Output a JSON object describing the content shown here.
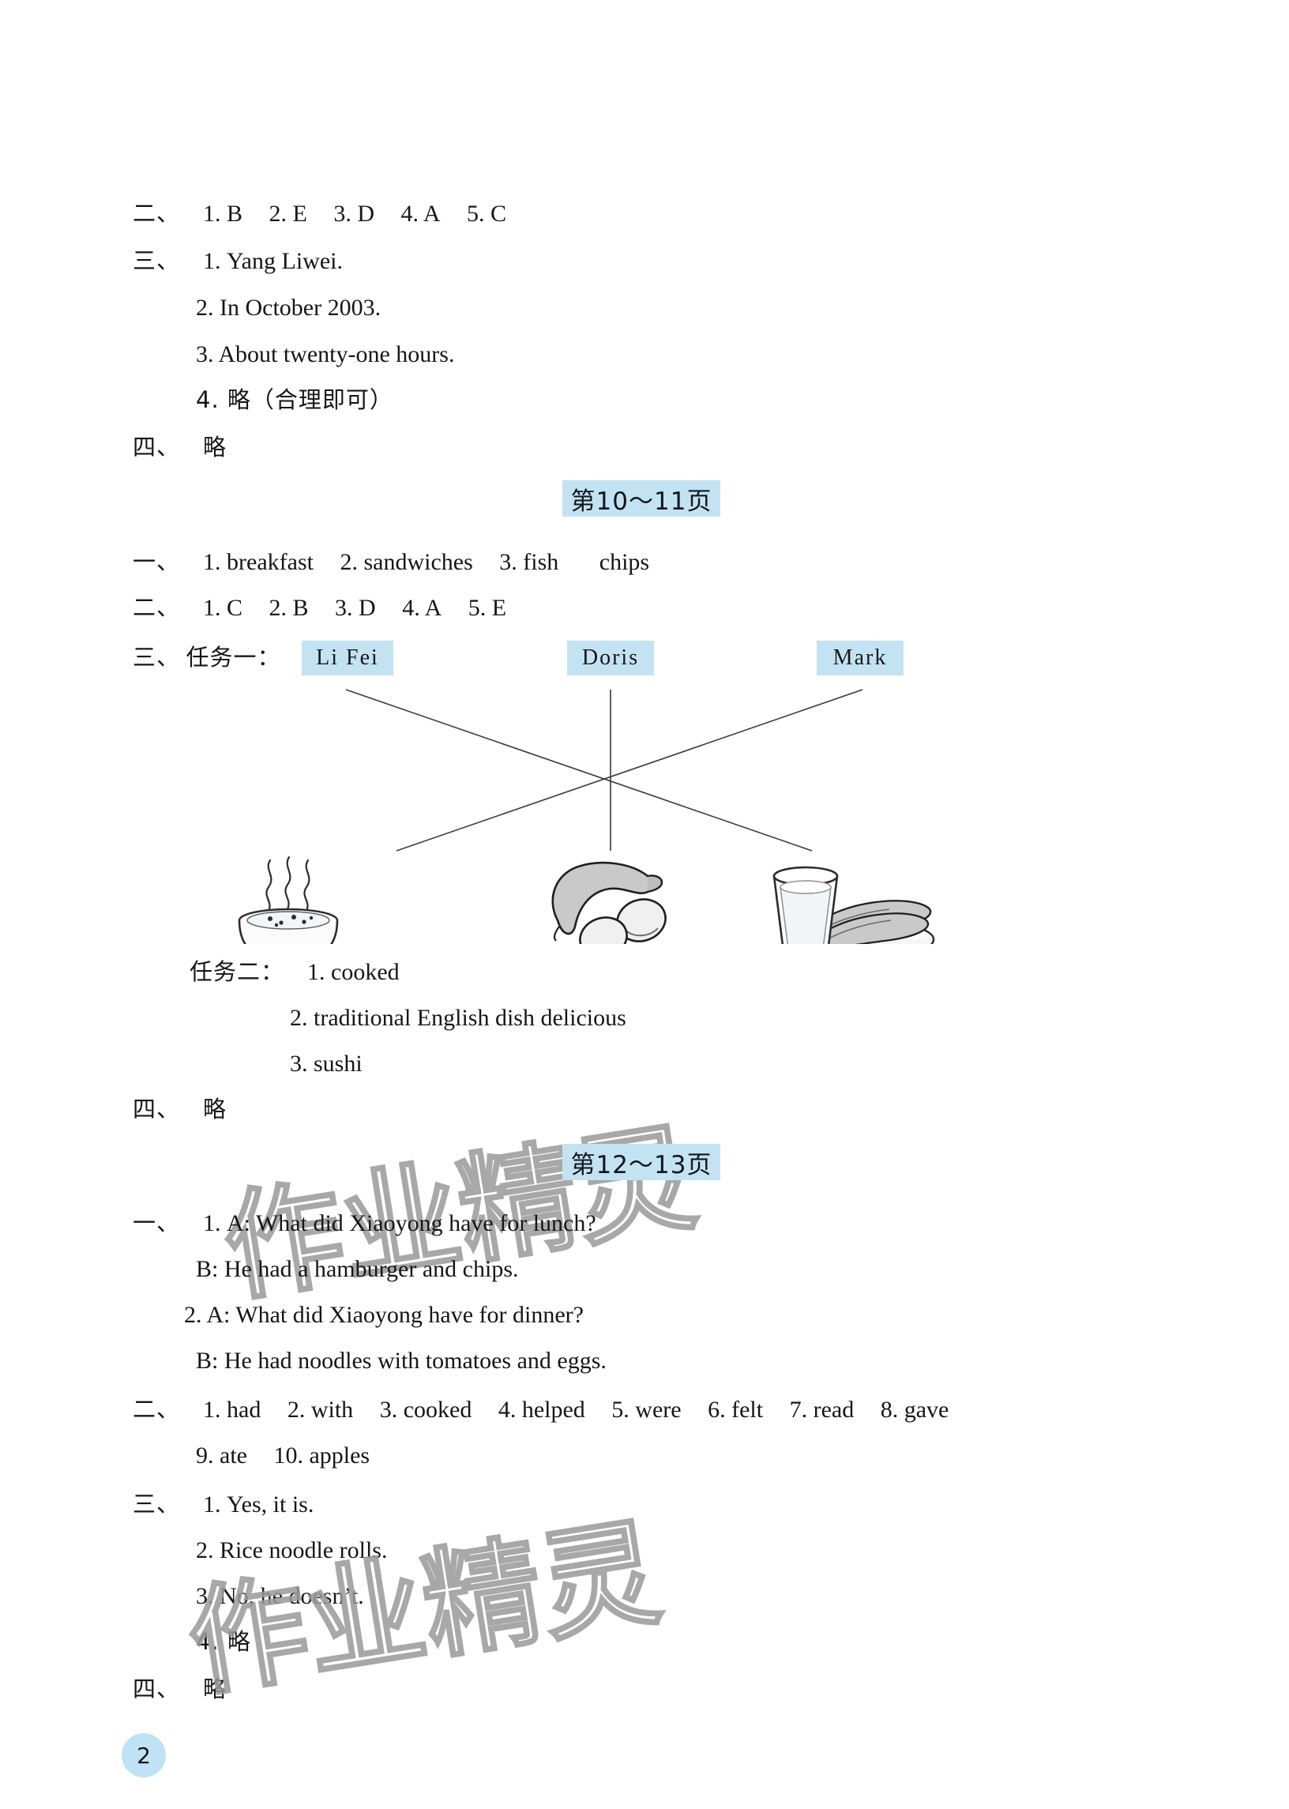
{
  "page": {
    "number": "2",
    "watermark": "作业精灵"
  },
  "sections": {
    "top": {
      "item_er": {
        "marker": "二、",
        "answers": [
          "1. B",
          "2. E",
          "3. D",
          "4. A",
          "5. C"
        ]
      },
      "item_san": {
        "marker": "三、",
        "lines": [
          "1. Yang  Liwei.",
          "2. In  October  2003.",
          "3. About  twenty-one  hours.",
          "4. 略（合理即可）"
        ]
      },
      "item_si": {
        "marker": "四、",
        "answer": "略"
      }
    },
    "banner_10_11": "第10～11页",
    "p10": {
      "item_yi": {
        "marker": "一、",
        "answers": [
          "1. breakfast",
          "2. sandwiches",
          "3. fish",
          "chips"
        ]
      },
      "item_er": {
        "marker": "二、",
        "answers": [
          "1. C",
          "2. B",
          "3. D",
          "4. A",
          "5. E"
        ]
      },
      "item_san": {
        "marker": "三、",
        "task_one_label": "任务一：",
        "names": [
          "Li  Fei",
          "Doris",
          "Mark"
        ],
        "foods": [
          "steaming-soup-bowl",
          "sausage-and-eggs",
          "milk-and-fried-dough-sticks"
        ],
        "task_two_label": "任务二：",
        "task_two_answers": [
          "1. cooked",
          "2. traditional  English  dish    delicious",
          "3. sushi"
        ]
      },
      "item_si": {
        "marker": "四、",
        "answer": "略"
      }
    },
    "banner_12_13": "第12～13页",
    "p12": {
      "item_yi": {
        "marker": "一、",
        "dialogues": [
          "1. A: What  did  Xiaoyong  have  for  lunch?",
          "B: He  had  a  hamburger  and  chips.",
          "2. A: What  did  Xiaoyong  have  for  dinner?",
          "B: He  had  noodles  with  tomatoes  and  eggs."
        ]
      },
      "item_er": {
        "marker": "二、",
        "answers_line1": [
          "1. had",
          "2. with",
          "3. cooked",
          "4. helped",
          "5. were",
          "6. felt",
          "7. read",
          "8. gave"
        ],
        "answers_line2": [
          "9. ate",
          "10. apples"
        ]
      },
      "item_san": {
        "marker": "三、",
        "lines": [
          "1. Yes,  it  is.",
          "2. Rice  noodle  rolls.",
          "3. No,  he  doesn’t.",
          "4. 略"
        ]
      },
      "item_si": {
        "marker": "四、",
        "answer": "略"
      }
    }
  },
  "colors": {
    "banner_blue": "#c4e3f2",
    "chip_blue": "#c4e3f2",
    "ink": "#16161a"
  }
}
